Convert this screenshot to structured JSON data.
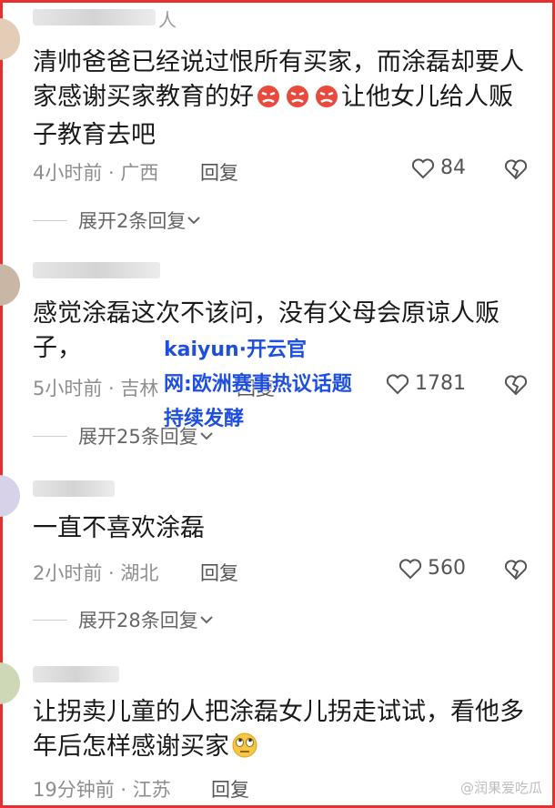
{
  "comments": [
    {
      "name_tail": "人",
      "text_before": "清帅爸爸已经说过恨所有买家，而涂磊却要人家感谢买家教育的好",
      "text_after": "让他女儿给人贩子教育去吧",
      "time_location": "4小时前 · 广西",
      "reply": "回复",
      "likes": "84",
      "expand": "展开2条回复"
    },
    {
      "text": "感觉涂磊这次不该问，没有父母会原谅人贩子，",
      "time_location": "5小时前 · 吉林",
      "reply": "回复",
      "likes": "1781",
      "expand": "展开25条回复"
    },
    {
      "text": "一直不喜欢涂磊",
      "time_location": "2小时前 · 湖北",
      "reply": "回复",
      "likes": "560",
      "expand": "展开28条回复"
    },
    {
      "text": "让拐卖儿童的人把涂磊女儿拐走试试，看他多年后怎样感谢买家",
      "time_location": "19分钟前 · 江苏",
      "reply": "回复"
    }
  ],
  "overlay": {
    "line1": "kaiyun·开云官",
    "line2": "网:欧洲赛事热议话题",
    "line3": "持续发酵"
  },
  "watermark": "@润果爱吃瓜",
  "colors": {
    "frame": "#e5302e",
    "overlay_text": "#1e4fe0"
  }
}
